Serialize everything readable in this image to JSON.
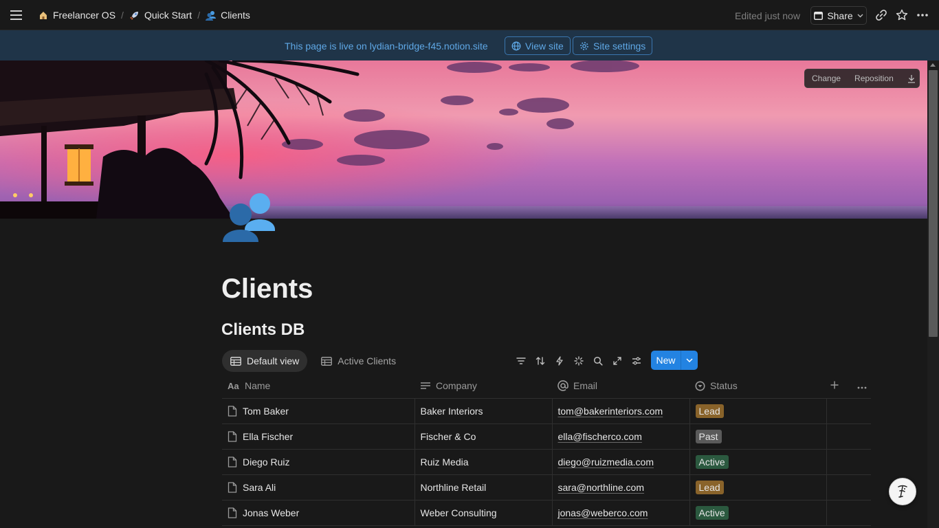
{
  "breadcrumbs": [
    {
      "label": "Freelancer OS"
    },
    {
      "label": "Quick Start"
    },
    {
      "label": "Clients"
    }
  ],
  "topbar": {
    "edited": "Edited just now",
    "share": "Share"
  },
  "banner": {
    "text": "This page is live on lydian-bridge-f45.notion.site",
    "view_site": "View site",
    "site_settings": "Site settings"
  },
  "cover": {
    "change": "Change",
    "reposition": "Reposition"
  },
  "page": {
    "title": "Clients",
    "icon": "busts-in-silhouette-icon"
  },
  "database": {
    "title": "Clients DB",
    "views": [
      "Default view",
      "Active Clients"
    ],
    "new_label": "New",
    "columns": [
      "Name",
      "Company",
      "Email",
      "Status"
    ],
    "rows": [
      {
        "name": "Tom Baker",
        "company": "Baker Interiors",
        "email": "tom@bakerinteriors.com",
        "status": "Lead"
      },
      {
        "name": "Ella Fischer",
        "company": "Fischer & Co",
        "email": "ella@fischerco.com",
        "status": "Past"
      },
      {
        "name": "Diego Ruiz",
        "company": "Ruiz Media",
        "email": "diego@ruizmedia.com",
        "status": "Active"
      },
      {
        "name": "Sara Ali",
        "company": "Northline Retail",
        "email": "sara@northline.com",
        "status": "Lead"
      },
      {
        "name": "Jonas Weber",
        "company": "Weber Consulting",
        "email": "jonas@weberco.com",
        "status": "Active"
      }
    ]
  },
  "colors": {
    "accent": "#2383e2",
    "status_lead": "#89632a",
    "status_past": "#5a5a5a",
    "status_active": "#2b593f",
    "banner_bg": "#1f3448"
  }
}
